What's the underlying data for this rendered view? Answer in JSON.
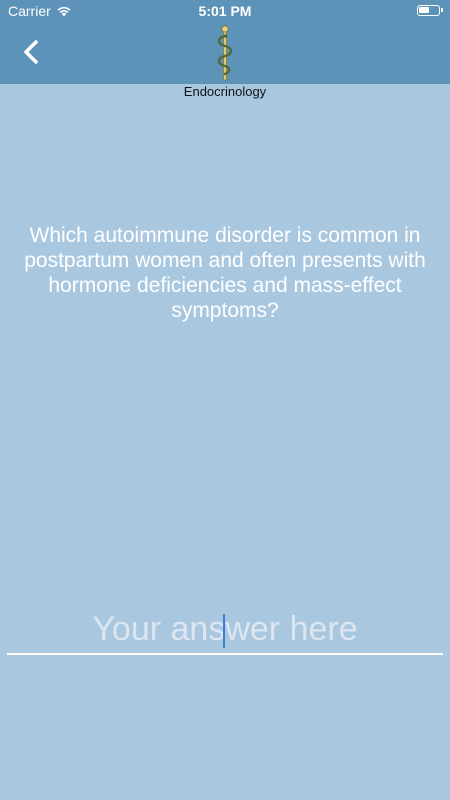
{
  "status_bar": {
    "carrier": "Carrier",
    "time": "5:01 PM"
  },
  "header": {
    "logo_icon": "rod-of-asclepius-icon",
    "back_icon": "chevron-left-icon",
    "subject": "Endocrinology"
  },
  "question": {
    "text": "Which autoimmune disorder is common in postpartum women and often presents with hormone deficiencies and mass-effect symptoms?"
  },
  "answer": {
    "placeholder": "Your answer here",
    "value": ""
  },
  "colors": {
    "header_bg": "#5e93b9",
    "page_bg": "#a9c8e0",
    "caret": "#3b7bdc"
  }
}
